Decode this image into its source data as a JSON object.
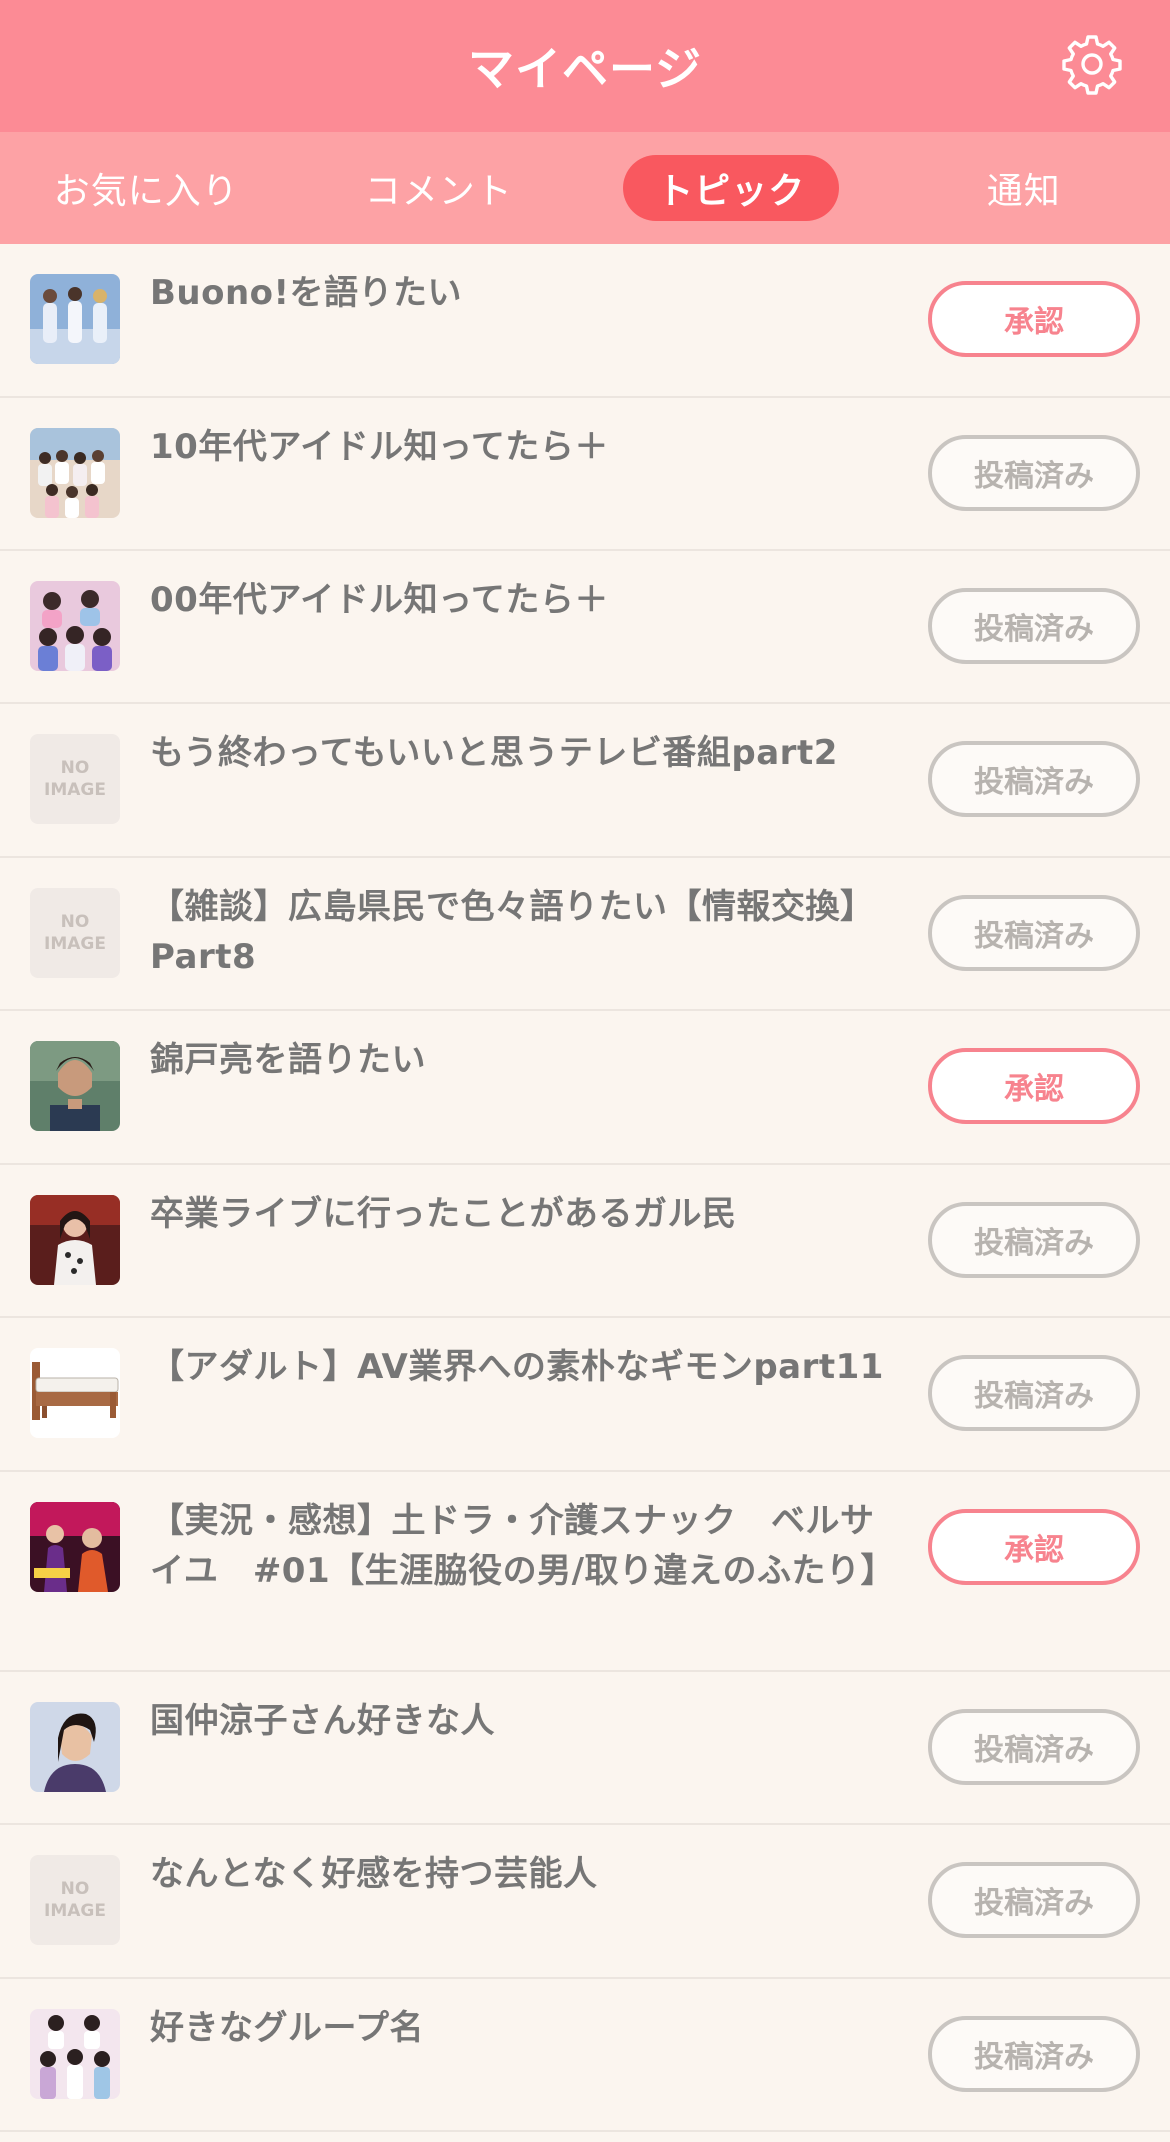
{
  "header": {
    "title": "マイページ"
  },
  "tabs": [
    {
      "label": "お気に入り",
      "active": false
    },
    {
      "label": "コメント",
      "active": false
    },
    {
      "label": "トピック",
      "active": true
    },
    {
      "label": "通知",
      "active": false
    }
  ],
  "no_image": {
    "line1": "NO",
    "line2": "IMAGE"
  },
  "topics": [
    {
      "title": "Buono!を語りたい",
      "status": "承認",
      "thumb": "group-photo"
    },
    {
      "title": "10年代アイドル知ってたら＋",
      "status": "投稿済み",
      "thumb": "group-photo"
    },
    {
      "title": "00年代アイドル知ってたら＋",
      "status": "投稿済み",
      "thumb": "group-photo"
    },
    {
      "title": "もう終わってもいいと思うテレビ番組part2",
      "status": "投稿済み",
      "thumb": "no-image"
    },
    {
      "title": "【雑談】広島県民で色々語りたい【情報交換】Part8",
      "status": "投稿済み",
      "thumb": "no-image"
    },
    {
      "title": "錦戸亮を語りたい",
      "status": "承認",
      "thumb": "person-photo"
    },
    {
      "title": "卒業ライブに行ったことがあるガル民",
      "status": "投稿済み",
      "thumb": "person-photo"
    },
    {
      "title": "【アダルト】AV業界への素朴なギモンpart11",
      "status": "投稿済み",
      "thumb": "bed-image"
    },
    {
      "title": "【実況・感想】土ドラ・介護スナック　ベルサイユ　#01【生涯脇役の男/取り違えのふたり】",
      "status": "承認",
      "thumb": "drama-photo"
    },
    {
      "title": "国仲涼子さん好きな人",
      "status": "投稿済み",
      "thumb": "person-photo"
    },
    {
      "title": "なんとなく好感を持つ芸能人",
      "status": "投稿済み",
      "thumb": "no-image"
    },
    {
      "title": "好きなグループ名",
      "status": "投稿済み",
      "thumb": "group-photo"
    }
  ],
  "colors": {
    "header": "#fc8b95",
    "tabs": "#fda2a5",
    "active_tab": "#f9585f",
    "approve": "#f7838e",
    "posted": "#c9c5c1",
    "background": "#fbf5ef"
  }
}
